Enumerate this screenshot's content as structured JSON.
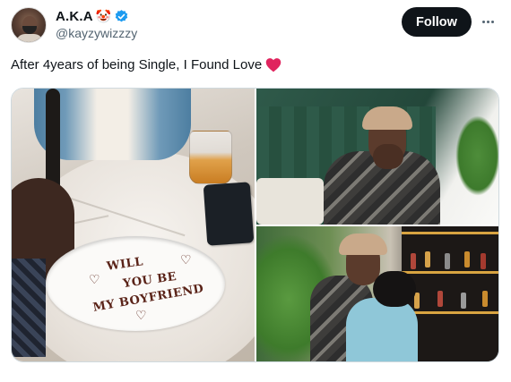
{
  "author": {
    "display_name": "A.K.A",
    "name_emoji": "🤡",
    "handle": "@kayzywizzzy",
    "verified": true
  },
  "actions": {
    "follow_label": "Follow"
  },
  "tweet": {
    "text": "After 4years of being Single, I Found Love",
    "trailing_emoji": "heart-icon"
  },
  "media": {
    "plate_lines": [
      "WILL",
      "YOU BE",
      "MY BOYFRIEND"
    ]
  },
  "colors": {
    "follow_bg": "#0f1419",
    "verified": "#1d9bf0",
    "heart": "#e0245e",
    "handle": "#536471"
  }
}
